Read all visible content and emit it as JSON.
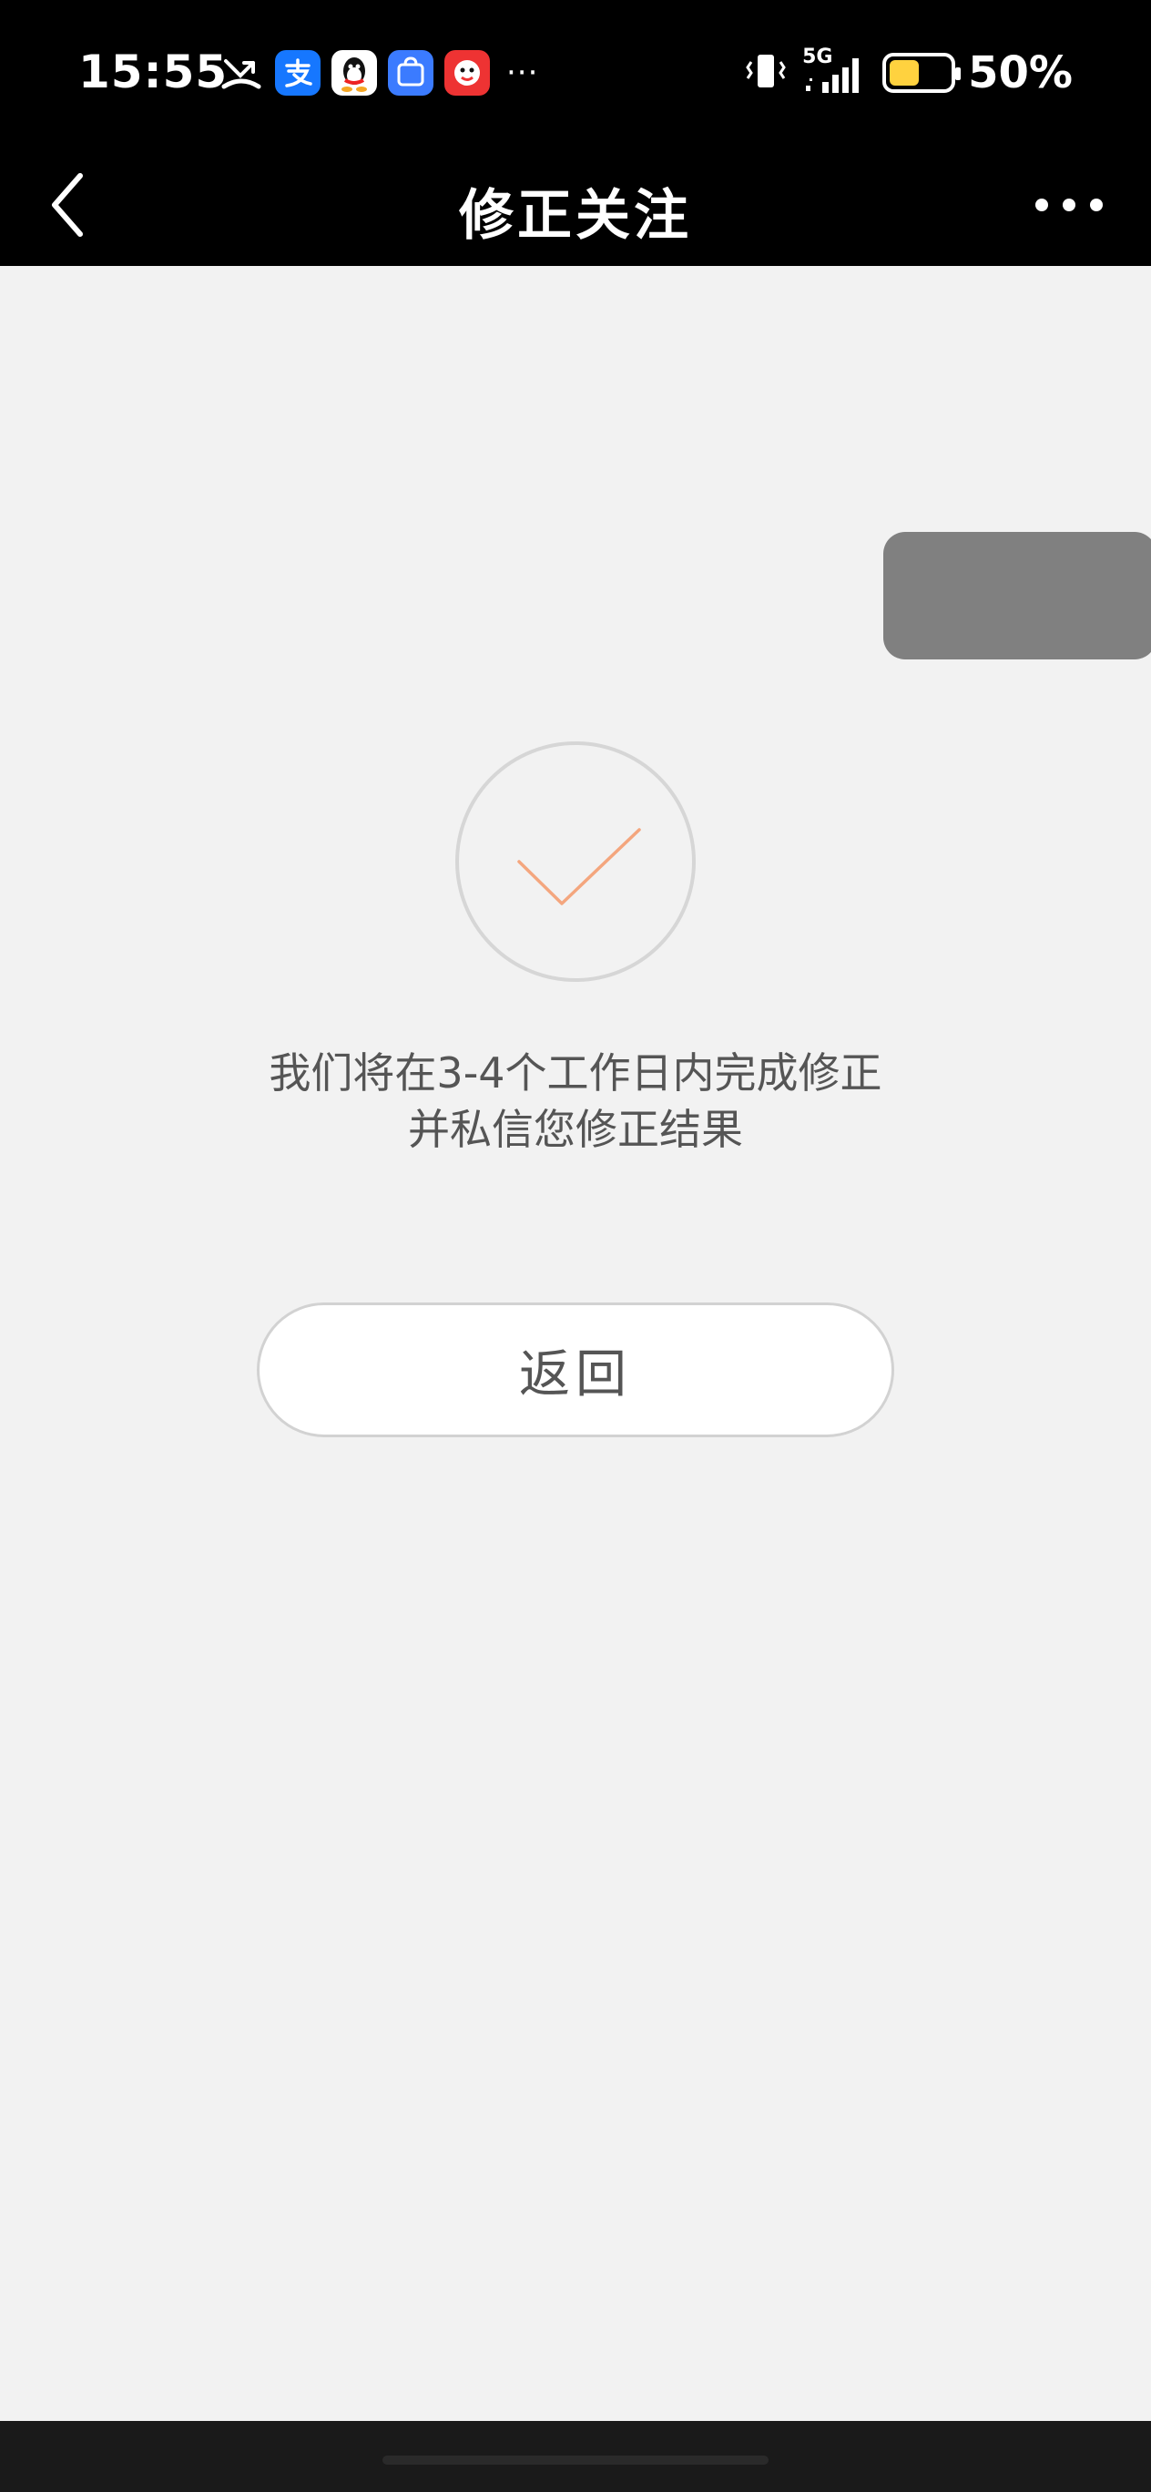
{
  "status_bar": {
    "time": "15:55",
    "notification_icons": [
      "missed-call-icon",
      "alipay-icon",
      "qq-icon",
      "app-market-icon",
      "game-icon"
    ],
    "more": "···",
    "network": "5G",
    "battery_percent": "50%",
    "battery_level": 0.5,
    "battery_color": "#ffd23f"
  },
  "nav": {
    "title": "修正关注"
  },
  "success": {
    "check_color": "#f4a67e",
    "message_line1": "我们将在3-4个工作日内完成修正",
    "message_line2": "并私信您修正结果"
  },
  "actions": {
    "return_label": "返回"
  }
}
